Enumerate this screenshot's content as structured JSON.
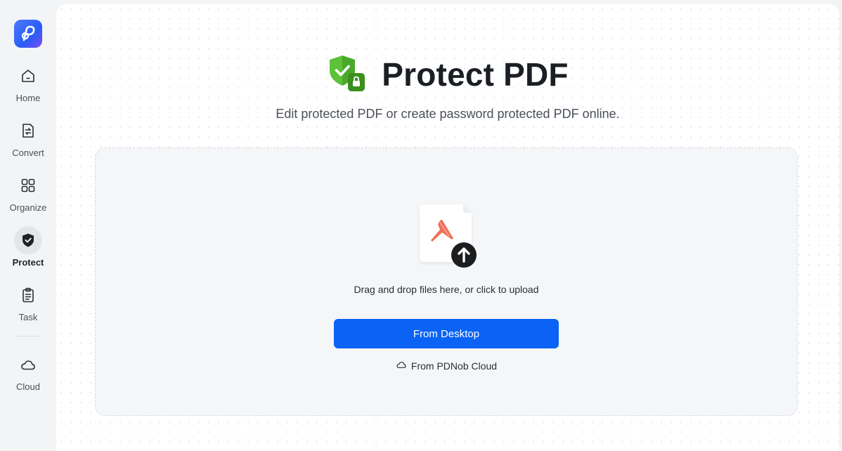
{
  "sidebar": {
    "logo_icon": "pdnob-logo-icon",
    "items": [
      {
        "label": "Home",
        "icon": "home-icon"
      },
      {
        "label": "Convert",
        "icon": "convert-icon"
      },
      {
        "label": "Organize",
        "icon": "grid-icon"
      },
      {
        "label": "Protect",
        "icon": "shield-icon",
        "active": true
      },
      {
        "label": "Task",
        "icon": "clipboard-icon"
      },
      {
        "label": "Cloud",
        "icon": "cloud-icon"
      }
    ]
  },
  "header": {
    "title": "Protect PDF",
    "icon": "shield-lock-icon",
    "subtitle": "Edit protected PDF or create password protected PDF online."
  },
  "dropzone": {
    "icon": "pdf-upload-icon",
    "instructions": "Drag and drop files here, or click to upload",
    "desktop_button_label": "From Desktop",
    "cloud_link_label": "From PDNob Cloud"
  },
  "colors": {
    "accent": "#0b63f6",
    "shield_green": "#4caf2a",
    "pdf_red": "#f0705a"
  }
}
